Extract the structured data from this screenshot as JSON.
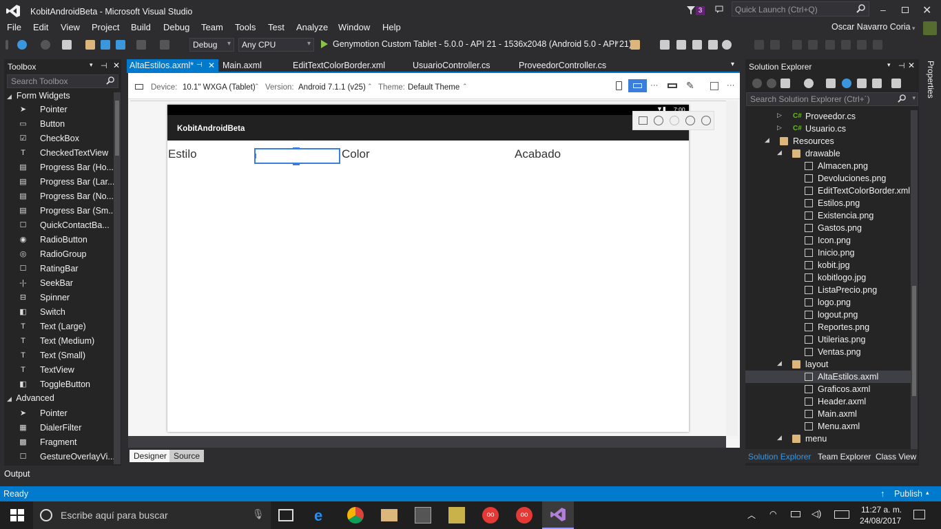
{
  "app": {
    "title": "KobitAndroidBeta - Microsoft Visual Studio",
    "notification_count": "3",
    "quick_launch_placeholder": "Quick Launch (Ctrl+Q)",
    "user": "Oscar Navarro Coria"
  },
  "menu": [
    "File",
    "Edit",
    "View",
    "Project",
    "Build",
    "Debug",
    "Team",
    "Tools",
    "Test",
    "Analyze",
    "Window",
    "Help"
  ],
  "toolbar": {
    "config": "Debug",
    "platform": "Any CPU",
    "run_target": "Genymotion Custom Tablet - 5.0.0 - API 21 - 1536x2048 (Android 5.0 - API 21)"
  },
  "toolbox": {
    "title": "Toolbox",
    "search_placeholder": "Search Toolbox",
    "group_form_widgets": "Form Widgets",
    "group_advanced": "Advanced",
    "form_widgets": [
      {
        "label": "Pointer",
        "icon": "pointer-icon"
      },
      {
        "label": "Button",
        "icon": "button-icon"
      },
      {
        "label": "CheckBox",
        "icon": "checkbox-icon"
      },
      {
        "label": "CheckedTextView",
        "icon": "text-icon"
      },
      {
        "label": "Progress Bar (Ho...",
        "icon": "progressbar-icon"
      },
      {
        "label": "Progress Bar (Lar...",
        "icon": "progressbar-icon"
      },
      {
        "label": "Progress Bar (No...",
        "icon": "progressbar-icon"
      },
      {
        "label": "Progress Bar (Sm...",
        "icon": "progressbar-icon"
      },
      {
        "label": "QuickContactBa...",
        "icon": "box-icon"
      },
      {
        "label": "RadioButton",
        "icon": "radio-icon"
      },
      {
        "label": "RadioGroup",
        "icon": "radiogroup-icon"
      },
      {
        "label": "RatingBar",
        "icon": "box-icon"
      },
      {
        "label": "SeekBar",
        "icon": "seekbar-icon"
      },
      {
        "label": "Spinner",
        "icon": "spinner-icon"
      },
      {
        "label": "Switch",
        "icon": "switch-icon"
      },
      {
        "label": "Text (Large)",
        "icon": "text-icon"
      },
      {
        "label": "Text (Medium)",
        "icon": "text-icon"
      },
      {
        "label": "Text (Small)",
        "icon": "text-icon"
      },
      {
        "label": "TextView",
        "icon": "text-icon"
      },
      {
        "label": "ToggleButton",
        "icon": "toggle-icon"
      }
    ],
    "advanced": [
      {
        "label": "Pointer",
        "icon": "pointer-icon"
      },
      {
        "label": "DialerFilter",
        "icon": "dialer-icon"
      },
      {
        "label": "Fragment",
        "icon": "fragment-icon"
      },
      {
        "label": "GestureOverlayVi...",
        "icon": "box-icon"
      }
    ]
  },
  "tabs": [
    "AltaEstilos.axml*",
    "Main.axml",
    "EditTextColorBorder.xml",
    "UsuarioController.cs",
    "ProveedorController.cs"
  ],
  "designer": {
    "device_label": "Device:",
    "device_value": "10.1\" WXGA (Tablet)",
    "version_label": "Version:",
    "version_value": "Android 7.1.1 (v25)",
    "theme_label": "Theme:",
    "theme_value": "Default Theme",
    "clock": "7:00",
    "app_title": "KobitAndroidBeta",
    "label_estilo": "Estilo",
    "label_color": "Color",
    "label_acabado": "Acabado",
    "tab_designer": "Designer",
    "tab_source": "Source"
  },
  "solution_explorer": {
    "title": "Solution Explorer",
    "search_placeholder": "Search Solution Explorer (Ctrl+´)",
    "nodes": [
      {
        "label": "Proveedor.cs",
        "type": "cs",
        "level": 1,
        "arrow": "▷"
      },
      {
        "label": "Usuario.cs",
        "type": "cs",
        "level": 1,
        "arrow": "▷"
      },
      {
        "label": "Resources",
        "type": "folder",
        "level": 0,
        "arrow": "◢"
      },
      {
        "label": "drawable",
        "type": "folder",
        "level": 1,
        "arrow": "◢"
      },
      {
        "label": "Almacen.png",
        "type": "file",
        "level": 2,
        "arrow": ""
      },
      {
        "label": "Devoluciones.png",
        "type": "file",
        "level": 2,
        "arrow": ""
      },
      {
        "label": "EditTextColorBorder.xml",
        "type": "file",
        "level": 2,
        "arrow": ""
      },
      {
        "label": "Estilos.png",
        "type": "file",
        "level": 2,
        "arrow": ""
      },
      {
        "label": "Existencia.png",
        "type": "file",
        "level": 2,
        "arrow": ""
      },
      {
        "label": "Gastos.png",
        "type": "file",
        "level": 2,
        "arrow": ""
      },
      {
        "label": "Icon.png",
        "type": "file",
        "level": 2,
        "arrow": ""
      },
      {
        "label": "Inicio.png",
        "type": "file",
        "level": 2,
        "arrow": ""
      },
      {
        "label": "kobit.jpg",
        "type": "file",
        "level": 2,
        "arrow": ""
      },
      {
        "label": "kobitlogo.jpg",
        "type": "file",
        "level": 2,
        "arrow": ""
      },
      {
        "label": "ListaPrecio.png",
        "type": "file",
        "level": 2,
        "arrow": ""
      },
      {
        "label": "logo.png",
        "type": "file",
        "level": 2,
        "arrow": ""
      },
      {
        "label": "logout.png",
        "type": "file",
        "level": 2,
        "arrow": ""
      },
      {
        "label": "Reportes.png",
        "type": "file",
        "level": 2,
        "arrow": ""
      },
      {
        "label": "Utilerias.png",
        "type": "file",
        "level": 2,
        "arrow": ""
      },
      {
        "label": "Ventas.png",
        "type": "file",
        "level": 2,
        "arrow": ""
      },
      {
        "label": "layout",
        "type": "folder",
        "level": 1,
        "arrow": "◢"
      },
      {
        "label": "AltaEstilos.axml",
        "type": "file",
        "level": 2,
        "arrow": "",
        "selected": true
      },
      {
        "label": "Graficos.axml",
        "type": "file",
        "level": 2,
        "arrow": ""
      },
      {
        "label": "Header.axml",
        "type": "file",
        "level": 2,
        "arrow": ""
      },
      {
        "label": "Main.axml",
        "type": "file",
        "level": 2,
        "arrow": ""
      },
      {
        "label": "Menu.axml",
        "type": "file",
        "level": 2,
        "arrow": ""
      },
      {
        "label": "menu",
        "type": "folder",
        "level": 1,
        "arrow": "◢"
      }
    ],
    "bottom_tabs": [
      "Solution Explorer",
      "Team Explorer",
      "Class View"
    ]
  },
  "properties_label": "Properties",
  "output_label": "Output",
  "status": {
    "text": "Ready",
    "publish": "Publish"
  },
  "taskbar": {
    "search_placeholder": "Escribe aquí para buscar",
    "time": "11:27 a. m.",
    "date": "24/08/2017"
  },
  "colors": {
    "accent": "#007acc",
    "background": "#2d2d30",
    "panel": "#252526"
  }
}
